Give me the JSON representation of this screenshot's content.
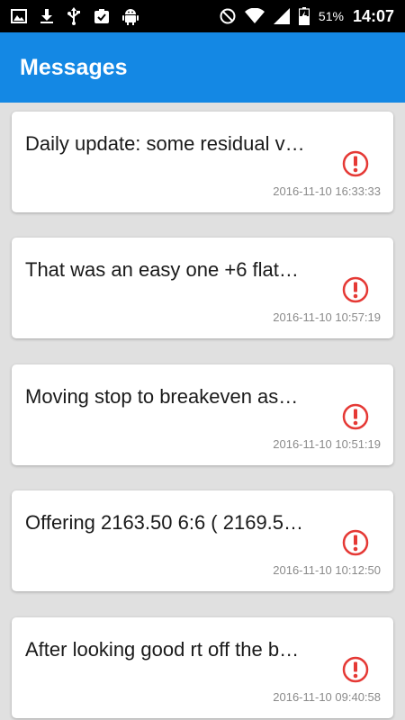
{
  "status_bar": {
    "battery_percent": "51%",
    "time": "14:07",
    "left_icons": [
      "image-icon",
      "download-icon",
      "usb-icon",
      "clipboard-check-icon",
      "android-icon"
    ],
    "right_icons": [
      "do-not-disturb-icon",
      "wifi-icon",
      "signal-icon",
      "battery-charging-icon"
    ]
  },
  "app_bar": {
    "title": "Messages"
  },
  "colors": {
    "app_bar": "#1488e4",
    "alert": "#e53935",
    "background": "#e0e0e0"
  },
  "messages": [
    {
      "text": "Daily update: some residual v…",
      "timestamp": "2016-11-10 16:33:33",
      "icon": "alert-icon"
    },
    {
      "text": "That was an easy one +6 flat…",
      "timestamp": "2016-11-10 10:57:19",
      "icon": "alert-icon"
    },
    {
      "text": "Moving stop to breakeven as…",
      "timestamp": "2016-11-10 10:51:19",
      "icon": "alert-icon"
    },
    {
      "text": "Offering 2163.50 6:6 ( 2169.5…",
      "timestamp": "2016-11-10 10:12:50",
      "icon": "alert-icon"
    },
    {
      "text": "After looking good rt off the b…",
      "timestamp": "2016-11-10 09:40:58",
      "icon": "alert-icon"
    }
  ]
}
